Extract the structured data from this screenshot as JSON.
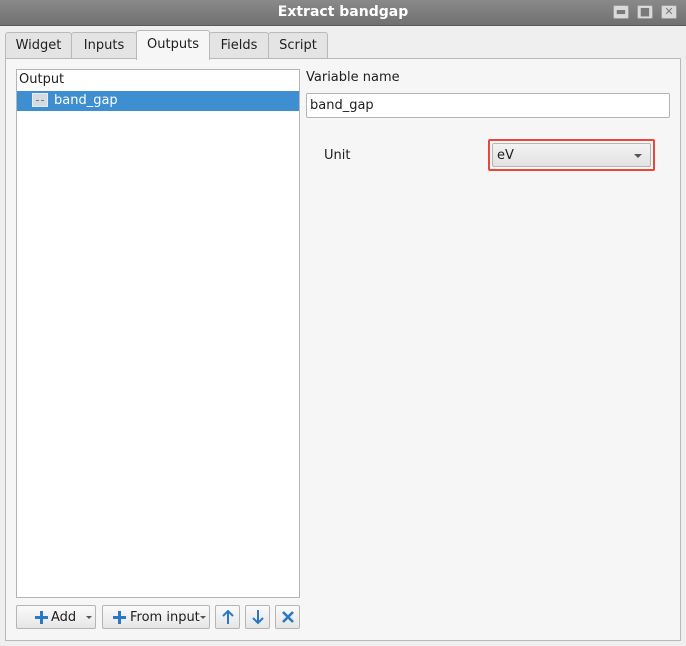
{
  "window": {
    "title": "Extract bandgap",
    "minimize_glyph": "▬",
    "maximize_glyph": "■",
    "close_glyph": "✕"
  },
  "tabs": [
    {
      "label": "Widget"
    },
    {
      "label": "Inputs"
    },
    {
      "label": "Outputs",
      "active": true
    },
    {
      "label": "Fields"
    },
    {
      "label": "Script"
    }
  ],
  "outputs_list": {
    "header": "Output",
    "items": [
      {
        "label": "band_gap",
        "icon": "output-variable-icon",
        "selected": true
      }
    ]
  },
  "variable": {
    "label": "Variable name",
    "value": "band_gap"
  },
  "unit": {
    "label": "Unit",
    "selected": "eV",
    "highlight_color": "#e8473c"
  },
  "toolbar": {
    "add_label": "Add",
    "from_input_label": "From input",
    "move_up_icon": "arrow-up-icon",
    "move_down_icon": "arrow-down-icon",
    "delete_icon": "delete-x-icon"
  },
  "colors": {
    "selection": "#3d8fd2",
    "accent_icon": "#2a78c4"
  }
}
